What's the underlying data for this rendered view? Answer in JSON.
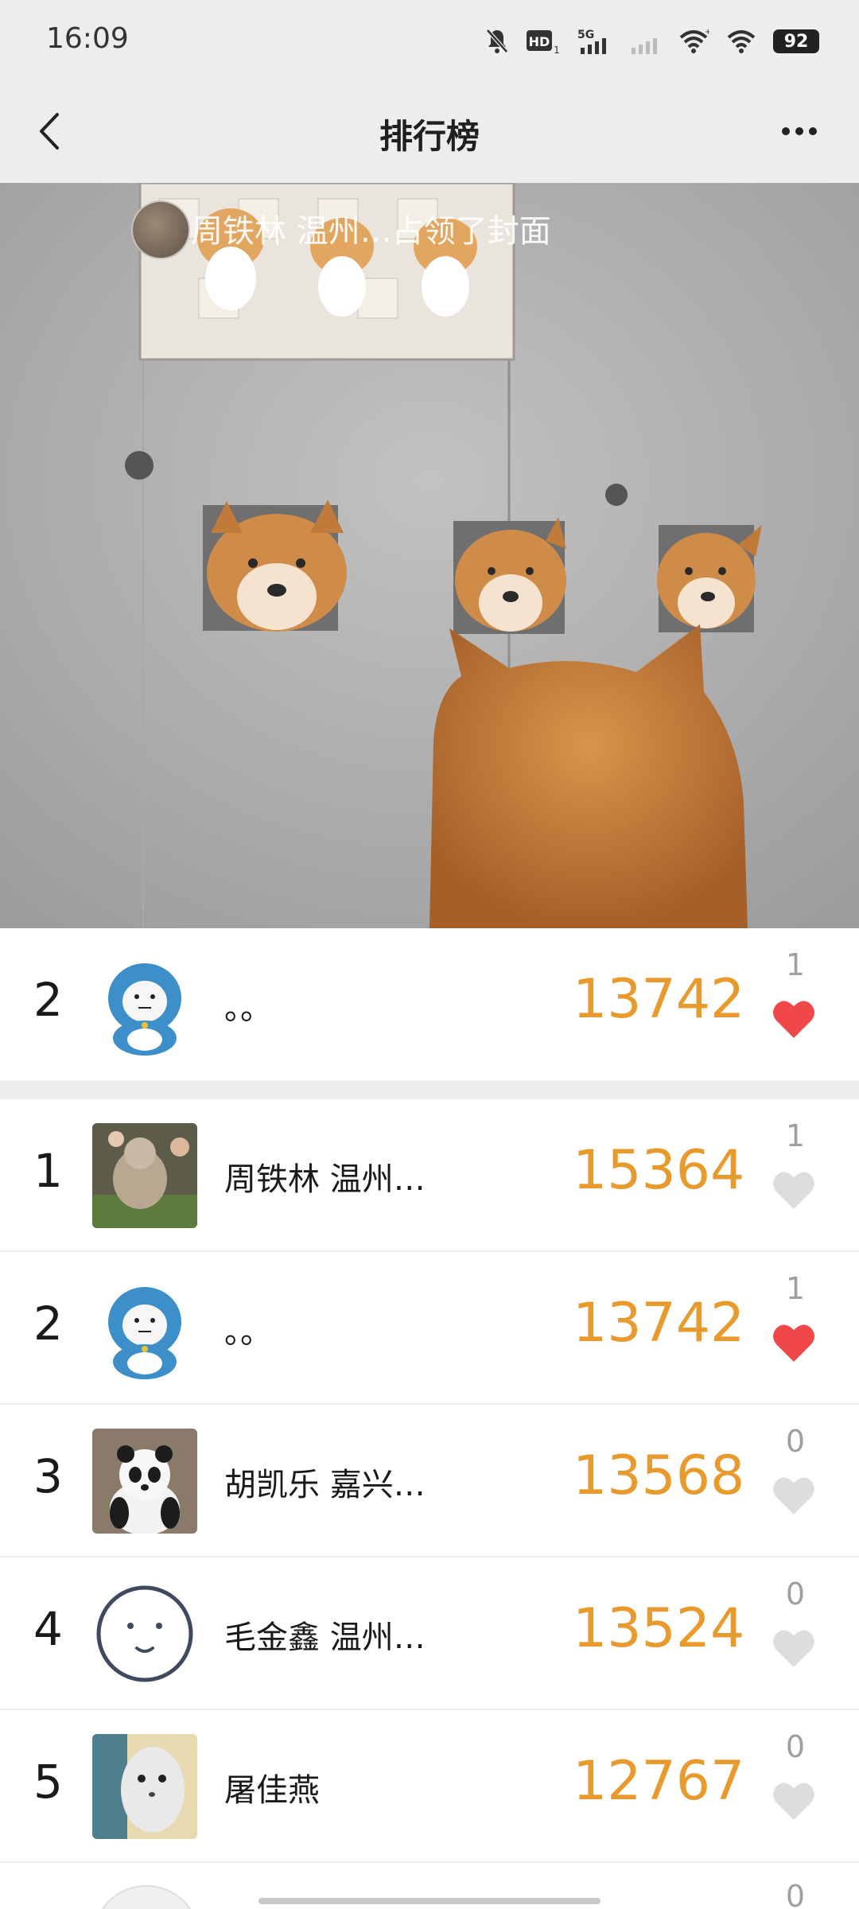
{
  "status_bar": {
    "time": "16:09",
    "icons": [
      "mute-bell-icon",
      "hd-icon",
      "5g-signal-icon",
      "signal-icon",
      "wifi-icon",
      "wifi-icon"
    ],
    "battery": "92"
  },
  "nav": {
    "title": "排行榜",
    "back_icon": "chevron-left-icon",
    "more_icon": "more-dots-icon"
  },
  "banner": {
    "caption": "周铁林 温州…占领了封面"
  },
  "my_rank": {
    "rank": "2",
    "name": "。。",
    "steps": "13742",
    "likes": "1",
    "liked": true
  },
  "rankings": [
    {
      "rank": "1",
      "name": "周铁林 温州…",
      "steps": "15364",
      "likes": "1",
      "liked": false
    },
    {
      "rank": "2",
      "name": "。。",
      "steps": "13742",
      "likes": "1",
      "liked": true
    },
    {
      "rank": "3",
      "name": "胡凯乐 嘉兴…",
      "steps": "13568",
      "likes": "0",
      "liked": false
    },
    {
      "rank": "4",
      "name": "毛金鑫 温州…",
      "steps": "13524",
      "likes": "0",
      "liked": false
    },
    {
      "rank": "5",
      "name": "屠佳燕",
      "steps": "12767",
      "likes": "0",
      "liked": false
    }
  ],
  "next_row_likes": "0",
  "colors": {
    "steps": "#e99a2c",
    "heart_active": "#f04848",
    "heart_inactive": "#dddddd",
    "background_bar": "#ededed"
  }
}
